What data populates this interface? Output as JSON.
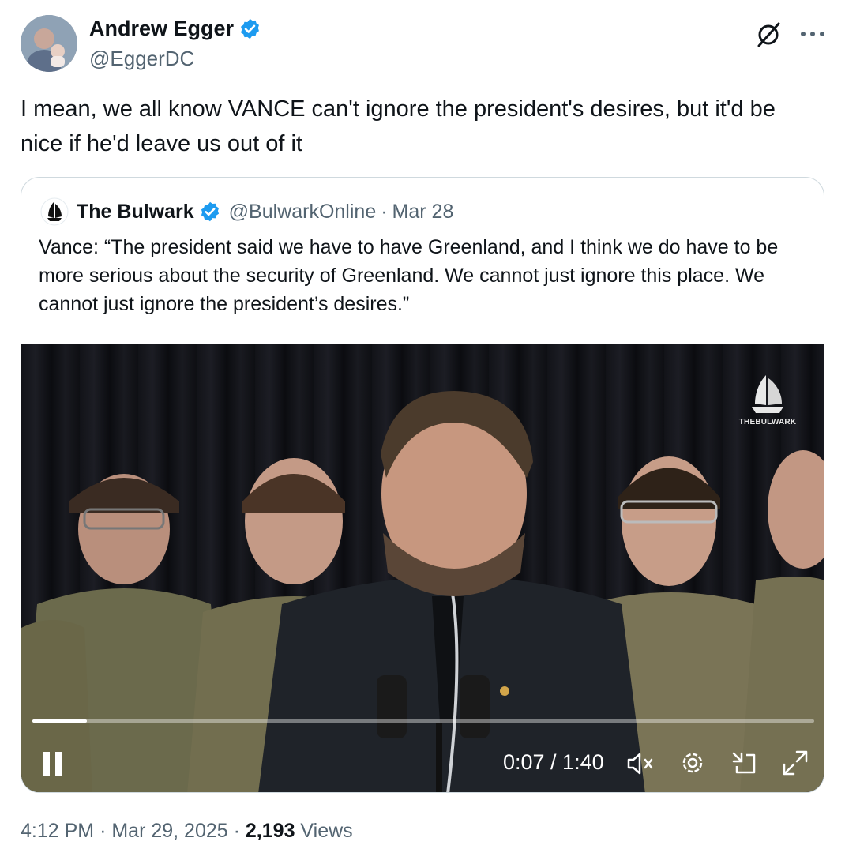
{
  "author": {
    "name": "Andrew Egger",
    "handle": "@EggerDC"
  },
  "tweet": {
    "text": "I mean, we all know VANCE can't ignore the president's desires, but it'd be nice if he'd leave us out of it"
  },
  "quoted": {
    "name": "The Bulwark",
    "handle": "@BulwarkOnline",
    "separator": "·",
    "date": "Mar 28",
    "text": "Vance: “The president said we have to have Greenland, and I think we do have to be more serious about the security of Greenland. We cannot just ignore this place. We cannot just ignore the president’s desires.”"
  },
  "video": {
    "watermark": "THEBULWARK",
    "time": "0:07 / 1:40",
    "progress": 0.07
  },
  "footer": {
    "time": "4:12 PM",
    "sep1": "·",
    "date": "Mar 29, 2025",
    "sep2": "·",
    "views_count": "2,193",
    "views_label": "Views"
  },
  "colors": {
    "verified": "#1d9bf0",
    "text_primary": "#0f1419",
    "text_secondary": "#536471",
    "border": "#cfd9de"
  },
  "icons": [
    "verified-badge-icon",
    "grok-icon",
    "more-icon",
    "bulwark-logo-icon",
    "pause-icon",
    "mute-icon",
    "settings-icon",
    "dock-icon",
    "fullscreen-icon"
  ]
}
